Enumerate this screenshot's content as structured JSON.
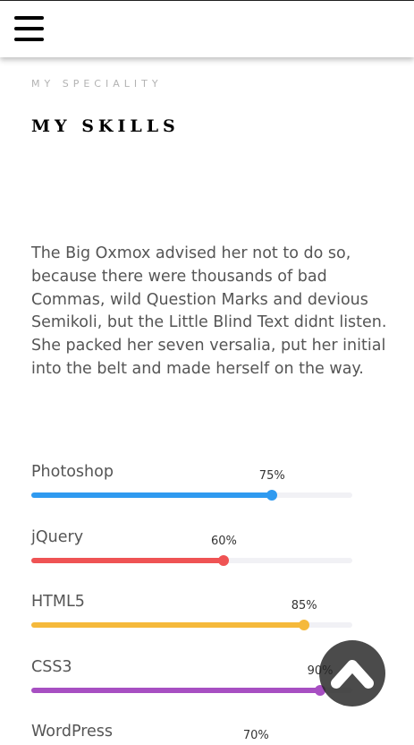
{
  "header": {
    "menu_icon": "hamburger-menu-icon"
  },
  "section": {
    "subheading": "MY SPECIALITY",
    "heading": "MY SKILLS",
    "intro": "The Big Oxmox advised her not to do so, because there were thousands of bad Commas, wild Question Marks and devious Semikoli, but the Little Blind Text didnt listen. She packed her seven versalia, put her initial into the belt and made herself on the way."
  },
  "skills": [
    {
      "name": "Photoshop",
      "percent": 75,
      "label": "75%",
      "color": "#2f9af0"
    },
    {
      "name": "jQuery",
      "percent": 60,
      "label": "60%",
      "color": "#ef5354"
    },
    {
      "name": "HTML5",
      "percent": 85,
      "label": "85%",
      "color": "#f5b93b"
    },
    {
      "name": "CSS3",
      "percent": 90,
      "label": "90%",
      "color": "#a74fc2"
    },
    {
      "name": "WordPress",
      "percent": 70,
      "label": "70%",
      "color": "#2f9af0"
    }
  ],
  "scroll_top": {
    "icon": "chevron-up-icon"
  }
}
